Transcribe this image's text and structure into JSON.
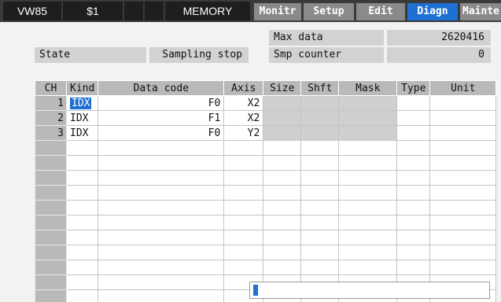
{
  "topbar": {
    "screen_id": "VW85",
    "system": "$1",
    "cell_3": "",
    "cell_4": "",
    "mode": "MEMORY",
    "tabs": [
      {
        "label": "Monitr",
        "active": false
      },
      {
        "label": "Setup",
        "active": false
      },
      {
        "label": "Edit",
        "active": false
      },
      {
        "label": "Diagn",
        "active": true
      },
      {
        "label": "Mainte",
        "active": false
      }
    ]
  },
  "info": {
    "state_label": "State",
    "state_value": "Sampling stop",
    "max_data_label": "Max data",
    "max_data_value": "2620416",
    "smp_counter_label": "Smp counter",
    "smp_counter_value": "0"
  },
  "table": {
    "headers": [
      "CH",
      "Kind",
      "Data code",
      "Axis",
      "Size",
      "Shft",
      "Mask",
      "Type",
      "Unit"
    ],
    "rows": [
      {
        "ch": "1",
        "kind": "IDX",
        "data_code": "F0",
        "axis": "X2",
        "size": "",
        "shft": "",
        "mask": "",
        "type": "",
        "unit": ""
      },
      {
        "ch": "2",
        "kind": "IDX",
        "data_code": "F1",
        "axis": "X2",
        "size": "",
        "shft": "",
        "mask": "",
        "type": "",
        "unit": ""
      },
      {
        "ch": "3",
        "kind": "IDX",
        "data_code": "F0",
        "axis": "Y2",
        "size": "",
        "shft": "",
        "mask": "",
        "type": "",
        "unit": ""
      }
    ],
    "selected_cell": "rows.0.kind"
  },
  "colors": {
    "accent": "#1e70d2",
    "header_bg": "#3a3a3a",
    "tab_bg": "#8a8a8a",
    "panel_bg": "#f2f2f2",
    "cell_gray": "#cfcfcf"
  },
  "input": {
    "value": ""
  }
}
